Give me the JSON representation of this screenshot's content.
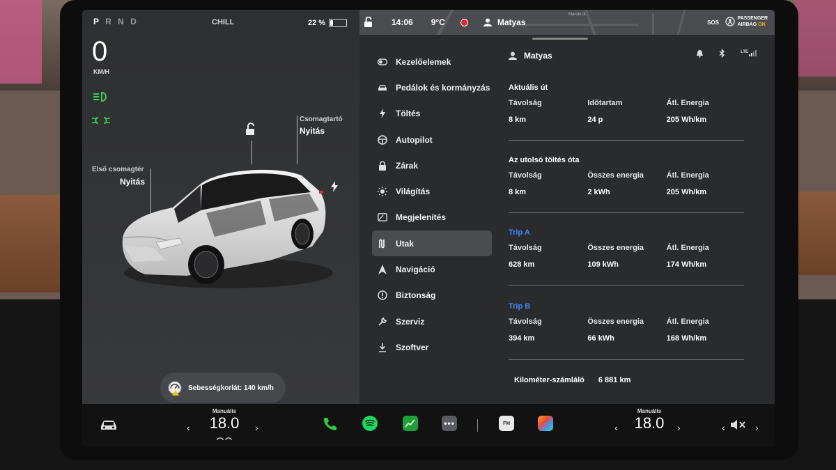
{
  "top": {
    "gears": [
      "P",
      "R",
      "N",
      "D"
    ],
    "active_gear": "P",
    "drive_mode": "CHILL",
    "battery_percent_label": "22 %",
    "battery_level": 0.22
  },
  "cluster": {
    "speed": "0",
    "speed_unit": "KM/H"
  },
  "car": {
    "frunk_label": "Első csomagtér",
    "frunk_action": "Nyitás",
    "trunk_label": "Csomagtartó",
    "trunk_action": "Nyitás"
  },
  "speed_limit": {
    "text": "Sebességkorlát: 140 km/h"
  },
  "status_bar": {
    "time": "14:06",
    "temperature": "9°C",
    "user": "Matyas",
    "sos": "SOS",
    "airbag_line1": "PASSENGER",
    "airbag_line2": "AIRBAG",
    "airbag_state": "ON",
    "map_label": "Maroki út"
  },
  "menu": {
    "items": [
      {
        "label": "Kezelőelemek",
        "icon": "toggle-icon",
        "active": false
      },
      {
        "label": "Pedálok és kormányzás",
        "icon": "car-icon",
        "active": false
      },
      {
        "label": "Töltés",
        "icon": "bolt-icon",
        "active": false
      },
      {
        "label": "Autopilot",
        "icon": "steering-wheel-icon",
        "active": false
      },
      {
        "label": "Zárak",
        "icon": "lock-icon",
        "active": false
      },
      {
        "label": "Világítás",
        "icon": "sun-icon",
        "active": false
      },
      {
        "label": "Megjelenítés",
        "icon": "display-icon",
        "active": false
      },
      {
        "label": "Utak",
        "icon": "trips-icon",
        "active": true
      },
      {
        "label": "Navigáció",
        "icon": "navigation-icon",
        "active": false
      },
      {
        "label": "Biztonság",
        "icon": "info-circle-icon",
        "active": false
      },
      {
        "label": "Szerviz",
        "icon": "wrench-icon",
        "active": false
      },
      {
        "label": "Szoftver",
        "icon": "download-icon",
        "active": false
      }
    ]
  },
  "content": {
    "profile_name": "Matyas",
    "signal": "LTE",
    "sections": [
      {
        "title": "Aktuális út",
        "is_trip": false,
        "metrics": [
          {
            "label": "Távolság",
            "value": "8 km"
          },
          {
            "label": "Időtartam",
            "value": "24 p"
          },
          {
            "label": "Átl. Energia",
            "value": "205 Wh/km"
          }
        ]
      },
      {
        "title": "Az utolsó töltés óta",
        "is_trip": false,
        "metrics": [
          {
            "label": "Távolság",
            "value": "8 km"
          },
          {
            "label": "Összes energia",
            "value": "2 kWh"
          },
          {
            "label": "Átl. Energia",
            "value": "205 Wh/km"
          }
        ]
      },
      {
        "title": "Trip A",
        "is_trip": true,
        "metrics": [
          {
            "label": "Távolság",
            "value": "628 km"
          },
          {
            "label": "Összes energia",
            "value": "109 kWh"
          },
          {
            "label": "Átl. Energia",
            "value": "174 Wh/km"
          }
        ]
      },
      {
        "title": "Trip B",
        "is_trip": true,
        "metrics": [
          {
            "label": "Távolság",
            "value": "394 km"
          },
          {
            "label": "Összes energia",
            "value": "66 kWh"
          },
          {
            "label": "Átl. Energia",
            "value": "168 Wh/km"
          }
        ]
      }
    ],
    "odometer_label": "Kilométer-számláló",
    "odometer_value": "6 881 km"
  },
  "bottom_bar": {
    "left_temp_label": "Manuális",
    "left_temp": "18.0",
    "right_temp_label": "Manuális",
    "right_temp": "18.0",
    "radio_label": "FM"
  },
  "colors": {
    "accent_blue": "#3e8bff",
    "light_green": "#39d353",
    "record_red": "#e5272b",
    "airbag_on": "#f5a623",
    "phone_green": "#2ecc40",
    "spotify_green": "#1ed760"
  }
}
